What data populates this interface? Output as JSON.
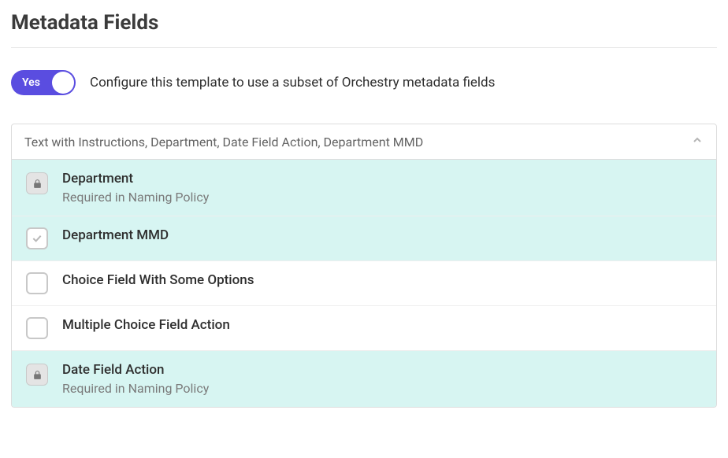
{
  "title": "Metadata Fields",
  "toggle": {
    "label": "Yes",
    "description": "Configure this template to use a subset of Orchestry metadata fields"
  },
  "panel": {
    "summary": "Text with Instructions, Department, Date Field Action, Department MMD"
  },
  "fields": [
    {
      "name": "Department",
      "subtitle": "Required in Naming Policy",
      "locked": true,
      "checked": true,
      "selected": true
    },
    {
      "name": "Department MMD",
      "subtitle": "",
      "locked": false,
      "checked": true,
      "selected": true
    },
    {
      "name": "Choice Field With Some Options",
      "subtitle": "",
      "locked": false,
      "checked": false,
      "selected": false
    },
    {
      "name": "Multiple Choice Field Action",
      "subtitle": "",
      "locked": false,
      "checked": false,
      "selected": false
    },
    {
      "name": "Date Field Action",
      "subtitle": "Required in Naming Policy",
      "locked": true,
      "checked": true,
      "selected": true
    }
  ]
}
